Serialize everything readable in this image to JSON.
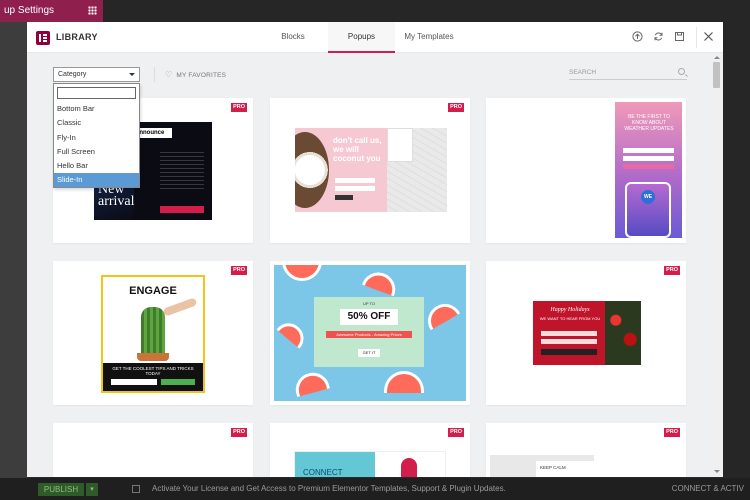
{
  "background": {
    "panel_title": "up Settings",
    "publish_label": "PUBLISH",
    "notice": "Activate Your License and Get Access to Premium Elementor Templates, Support & Plugin Updates.",
    "connect": "CONNECT & ACTIV"
  },
  "modal": {
    "title": "LIBRARY",
    "tabs": [
      {
        "label": "Blocks"
      },
      {
        "label": "Popups"
      },
      {
        "label": "My Templates"
      }
    ],
    "header_icons": [
      "upload-icon",
      "sync-icon",
      "save-icon",
      "close-icon"
    ]
  },
  "toolbar": {
    "category_label": "Category",
    "favorites_label": "MY FAVORITES",
    "search_placeholder": "SEARCH"
  },
  "dropdown": {
    "search_value": "",
    "options": [
      {
        "label": "Bottom Bar"
      },
      {
        "label": "Classic"
      },
      {
        "label": "Fly-In"
      },
      {
        "label": "Full Screen"
      },
      {
        "label": "Hello Bar"
      },
      {
        "label": "Slide-In"
      }
    ],
    "selected": "Slide-In"
  },
  "badge": "PRO",
  "templates": {
    "t1": {
      "heading": "Announce",
      "big": "New arrival"
    },
    "t2": {
      "heading": "don't call us, we will coconut you"
    },
    "t3": {
      "heading": "BE THE FIRST TO KNOW ABOUT WEATHER UPDATES",
      "app": "WE"
    },
    "t4": {
      "heading": "ENGAGE",
      "tagline": "GET THE COOLEST TIPS AND TRICKS TODAY"
    },
    "t5": {
      "pre": "UP TO",
      "heading": "50% OFF",
      "sub": "Awesome Products - Amazing Prices",
      "cta": "GET IT"
    },
    "t6": {
      "heading": "Happy Holidays",
      "sub": "WE WANT TO HEAR FROM YOU"
    },
    "t8": {
      "heading": "CONNECT"
    },
    "t9": {
      "heading": "KEEP CALM"
    }
  },
  "colors": {
    "accent": "#d31d4b",
    "brand": "#92003b",
    "selected_option": "#5b9bd5"
  }
}
